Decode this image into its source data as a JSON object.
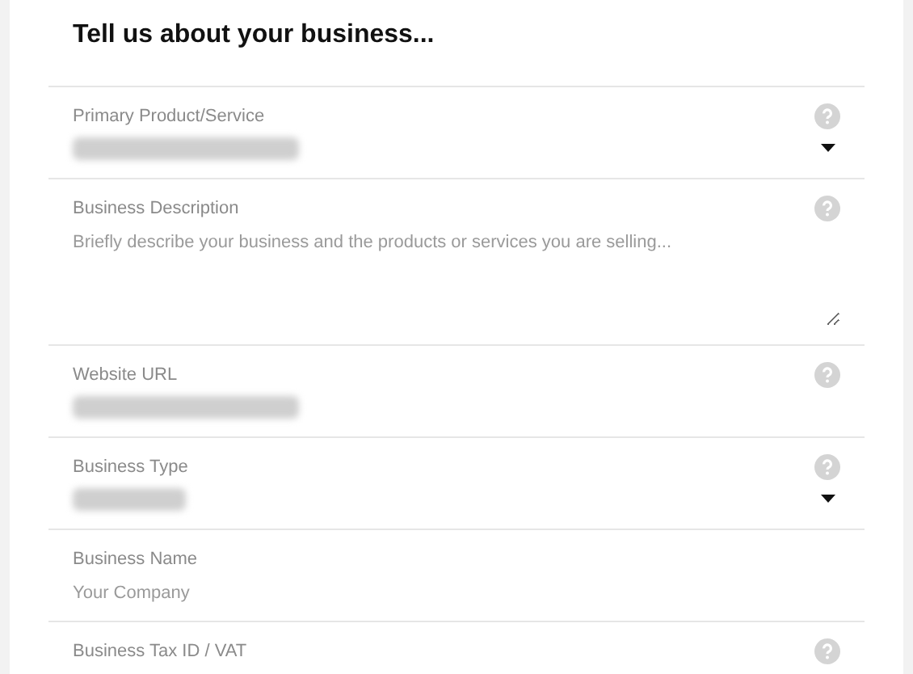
{
  "heading": "Tell us about your business...",
  "fields": [
    {
      "kind": "select",
      "label": "Primary Product/Service",
      "help": true,
      "redacted": true
    },
    {
      "kind": "textarea",
      "label": "Business Description",
      "help": true,
      "placeholder": "Briefly describe your business and the products or services you are selling..."
    },
    {
      "kind": "input",
      "label": "Website URL",
      "help": true,
      "redacted": true
    },
    {
      "kind": "select",
      "label": "Business Type",
      "help": true,
      "redacted": true
    },
    {
      "kind": "input",
      "label": "Business Name",
      "help": false,
      "placeholder": "Your Company"
    },
    {
      "kind": "input",
      "label": "Business Tax ID / VAT",
      "help": true
    }
  ]
}
